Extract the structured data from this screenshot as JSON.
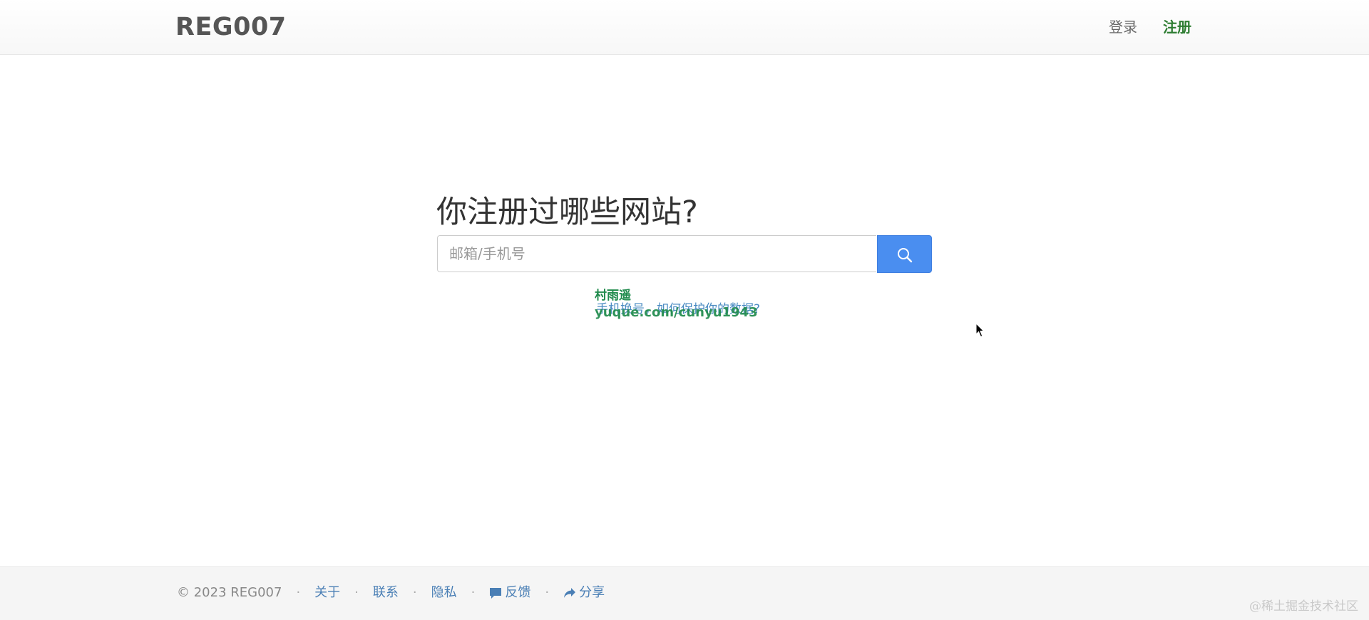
{
  "navbar": {
    "brand": "REG007",
    "login_label": "登录",
    "register_label": "注册"
  },
  "main": {
    "headline": "你注册过哪些网站?",
    "search": {
      "placeholder": "邮箱/手机号",
      "value": ""
    },
    "search_button_icon": "search-icon",
    "help_link": "手机换号，如何保护你的数据?"
  },
  "overlay_watermark": {
    "name": "村雨遥",
    "url": "yuque.com/cunyu1943"
  },
  "footer": {
    "copyright": "© 2023 REG007",
    "separator": "·",
    "links": {
      "about": "关于",
      "contact": "联系",
      "privacy": "隐私",
      "feedback": "反馈",
      "share": "分享"
    },
    "feedback_icon": "comment-icon",
    "share_icon": "share-icon"
  },
  "site_watermark": "@稀土掘金技术社区",
  "colors": {
    "accent": "#4a8ef0",
    "register": "#2e7d32",
    "link": "#4a7fb5",
    "watermark": "#1f8a4c"
  }
}
